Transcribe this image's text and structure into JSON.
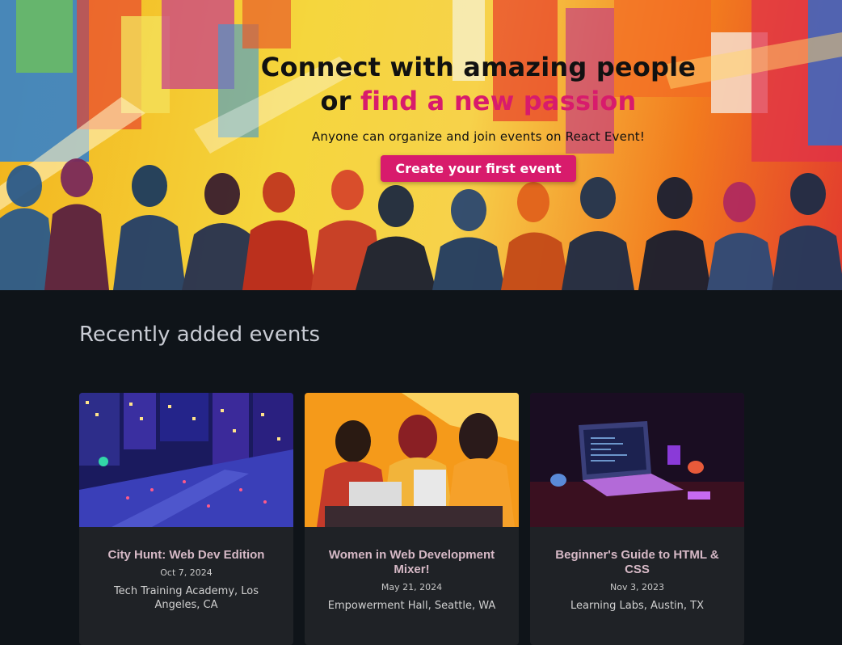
{
  "hero": {
    "title_line1": "Connect with amazing people",
    "title_line2_prefix": "or ",
    "title_line2_accent": "find a new passion",
    "subtitle": "Anyone can organize and join events on React Event!",
    "cta_label": "Create your first event",
    "accent_color": "#d81b6c"
  },
  "events_section": {
    "title": "Recently added events",
    "cards": [
      {
        "title": "City Hunt: Web Dev Edition",
        "date": "Oct 7, 2024",
        "location": "Tech Training Academy, Los Angeles, CA",
        "image": "city-night-illustration"
      },
      {
        "title": "Women in Web Development Mixer!",
        "date": "May 21, 2024",
        "location": "Empowerment Hall, Seattle, WA",
        "image": "women-laptops-illustration"
      },
      {
        "title": "Beginner's Guide to HTML & CSS",
        "date": "Nov 3, 2023",
        "location": "Learning Labs, Austin, TX",
        "image": "laptop-desk-illustration"
      }
    ]
  }
}
